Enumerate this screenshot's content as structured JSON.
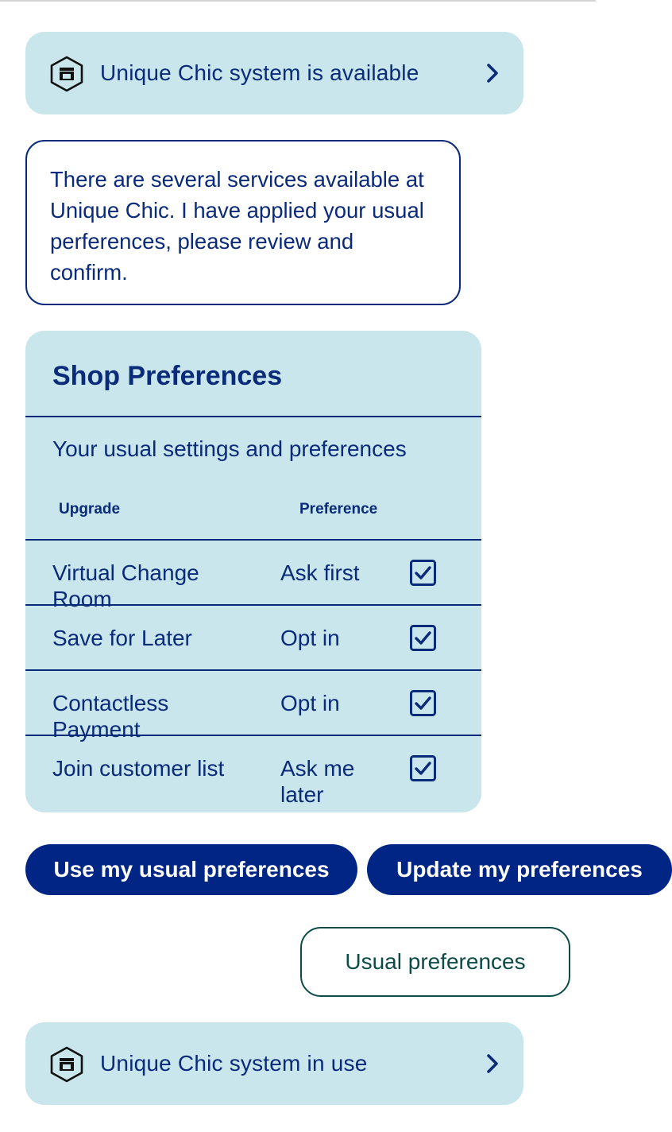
{
  "status_available": {
    "text": "Unique Chic system is available",
    "icon": "store-hexagon-icon"
  },
  "assistant_message": {
    "text": "There are several services available at Unique Chic. I have applied your usual perferences, please review and confirm."
  },
  "shop_preferences": {
    "title": "Shop Preferences",
    "subtitle": "Your usual settings and preferences",
    "column_upgrade": "Upgrade",
    "column_preference": "Preference",
    "rows": [
      {
        "upgrade": "Virtual Change Room",
        "preference": "Ask first",
        "checked": true
      },
      {
        "upgrade": "Save for Later",
        "preference": "Opt in",
        "checked": true
      },
      {
        "upgrade": "Contactless Payment",
        "preference": "Opt in",
        "checked": true
      },
      {
        "upgrade": "Join customer list",
        "preference": "Ask me later",
        "checked": true
      }
    ]
  },
  "actions": {
    "use_usual": "Use my usual preferences",
    "update": "Update my preferences"
  },
  "user_reply": {
    "text": "Usual preferences"
  },
  "status_in_use": {
    "text": "Unique Chic system in use",
    "icon": "store-hexagon-icon"
  },
  "colors": {
    "navy": "#0a2a7a",
    "button": "#002585",
    "card": "#c8e6ec",
    "reply": "#0c4b47"
  }
}
